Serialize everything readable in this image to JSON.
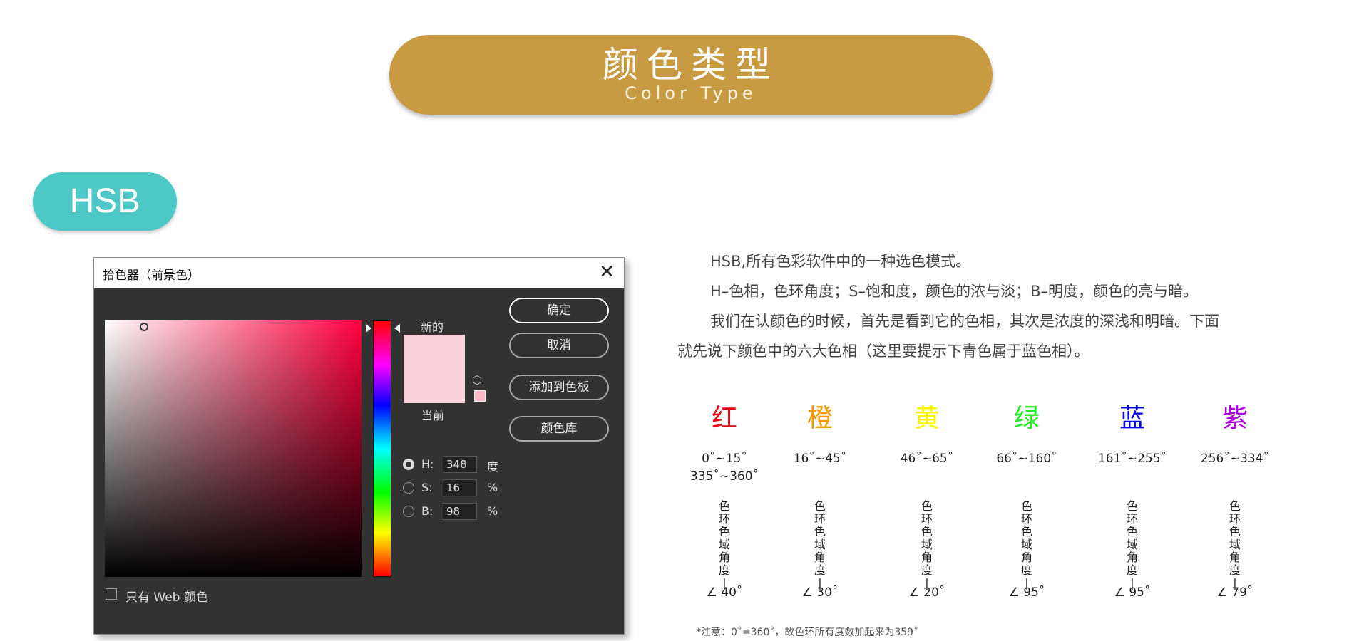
{
  "header": {
    "title_cn": "颜色类型",
    "title_en": "Color Type",
    "badge": "HSB"
  },
  "dialog": {
    "title": "拾色器（前景色）",
    "close_icon": "close-icon",
    "label_new": "新的",
    "label_current": "当前",
    "new_color": "#f9d1da",
    "current_color": "#f9d1da",
    "buttons": {
      "ok": "确定",
      "cancel": "取消",
      "add_swatch": "添加到色板",
      "color_library": "颜色库"
    },
    "fields": {
      "h_label": "H:",
      "h_value": "348",
      "h_unit": "度",
      "s_label": "S:",
      "s_value": "16",
      "s_unit": "%",
      "b_label": "B:",
      "b_value": "98",
      "b_unit": "%"
    },
    "web_only_label": "只有 Web 颜色"
  },
  "text": {
    "p1": "HSB,所有色彩软件中的一种选色模式。",
    "p2": "H–色相，色环角度；S–饱和度，颜色的浓与淡；B–明度，颜色的亮与暗。",
    "p3a": "我们在认颜色的时候，首先是看到它的色相，其次是浓度的深浅和明暗。下面",
    "p3b": "就先说下颜色中的六大色相（这里要提示下青色属于蓝色相）。"
  },
  "hues": [
    {
      "name": "红",
      "color": "#e60012",
      "range1": "0˚~15˚",
      "range2": "335˚~360˚",
      "angle": "∠ 40˚"
    },
    {
      "name": "橙",
      "color": "#f39800",
      "range1": "16˚~45˚",
      "range2": "",
      "angle": "∠ 30˚"
    },
    {
      "name": "黄",
      "color": "#fff100",
      "range1": "46˚~65˚",
      "range2": "",
      "angle": "∠ 20˚"
    },
    {
      "name": "绿",
      "color": "#22ee22",
      "range1": "66˚~160˚",
      "range2": "",
      "angle": "∠ 95˚"
    },
    {
      "name": "蓝",
      "color": "#0000e0",
      "range1": "161˚~255˚",
      "range2": "",
      "angle": "∠ 95˚"
    },
    {
      "name": "紫",
      "color": "#b000e0",
      "range1": "256˚~334˚",
      "range2": "",
      "angle": "∠ 79˚"
    }
  ],
  "vertical_label": [
    "色",
    "环",
    "色",
    "域",
    "角",
    "度",
    "|"
  ],
  "note": "*注意：0˚=360˚，故色环所有度数加起来为359˚"
}
